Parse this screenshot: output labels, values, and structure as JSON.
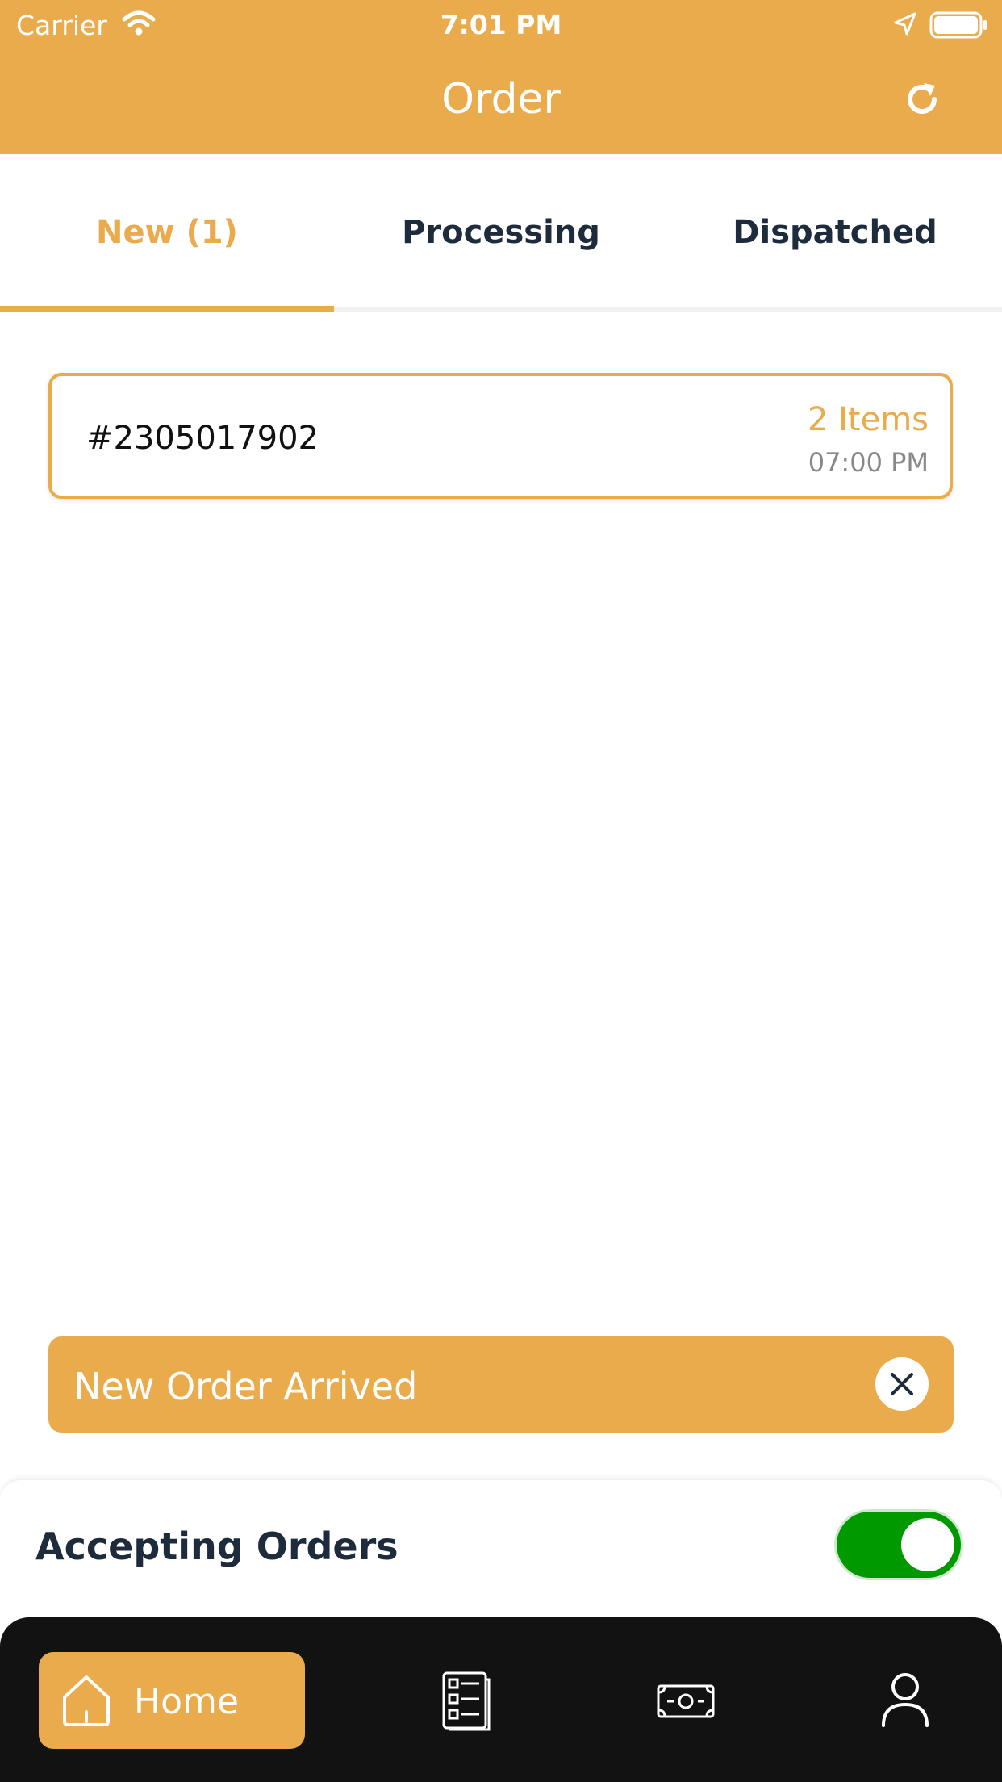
{
  "status_bar": {
    "carrier": "Carrier",
    "time": "7:01 PM"
  },
  "header": {
    "title": "Order"
  },
  "tabs": [
    {
      "label": "New (1)",
      "active": true
    },
    {
      "label": "Processing",
      "active": false
    },
    {
      "label": "Dispatched",
      "active": false
    }
  ],
  "order": {
    "id": "#2305017902",
    "items": "2 Items",
    "time": "07:00 PM"
  },
  "alert": {
    "text": "New Order Arrived"
  },
  "accepting": {
    "label": "Accepting Orders",
    "enabled": true
  },
  "bottom_nav": [
    {
      "label": "Home",
      "icon": "home-icon",
      "active": true
    },
    {
      "label": "",
      "icon": "orders-list-icon"
    },
    {
      "label": "",
      "icon": "money-icon"
    },
    {
      "label": "",
      "icon": "profile-icon"
    }
  ],
  "colors": {
    "accent": "#e9ab4c",
    "dark_text": "#1e2b3c",
    "toggle_on": "#009900",
    "nav_bg": "#121212"
  }
}
